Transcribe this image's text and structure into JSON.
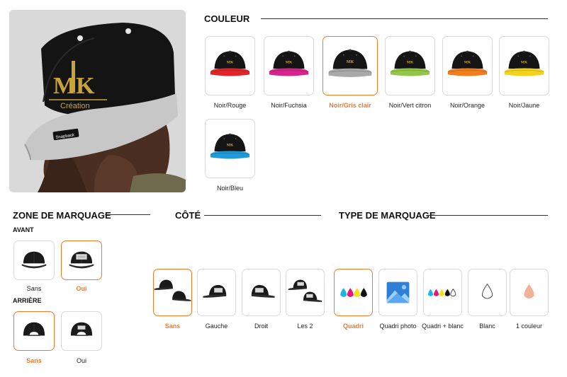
{
  "brand": {
    "logo_line1": "MK",
    "logo_line2": "Création",
    "badge": "Snapback"
  },
  "couleur": {
    "title": "COULEUR",
    "options": [
      {
        "label": "Noir/Rouge",
        "visor": "#e0252a",
        "selected": false
      },
      {
        "label": "Noir/Fuchsia",
        "visor": "#d6248d",
        "selected": false
      },
      {
        "label": "Noir/Gris clair",
        "visor": "#a9a9a9",
        "selected": true
      },
      {
        "label": "Noir/Vert citron",
        "visor": "#93c548",
        "selected": false
      },
      {
        "label": "Noir/Orange",
        "visor": "#f07e1e",
        "selected": false
      },
      {
        "label": "Noir/Jaune",
        "visor": "#f3d21f",
        "selected": false
      },
      {
        "label": "Noir/Bleu",
        "visor": "#1e9bd8",
        "selected": false
      }
    ]
  },
  "zone": {
    "title": "ZONE DE MARQUAGE",
    "avant_label": "AVANT",
    "arriere_label": "ARRIÈRE",
    "avant": [
      {
        "label": "Sans",
        "selected": false
      },
      {
        "label": "Oui",
        "selected": true
      }
    ],
    "arriere": [
      {
        "label": "Sans",
        "selected": true
      },
      {
        "label": "Oui",
        "selected": false
      }
    ]
  },
  "cote": {
    "title": "CÔTÉ",
    "options": [
      {
        "label": "Sans",
        "selected": true
      },
      {
        "label": "Gauche",
        "selected": false
      },
      {
        "label": "Droit",
        "selected": false
      },
      {
        "label": "Les 2",
        "selected": false
      }
    ]
  },
  "type": {
    "title": "TYPE DE MARQUAGE",
    "options": [
      {
        "label": "Quadri",
        "selected": true
      },
      {
        "label": "Quadri photo",
        "selected": false
      },
      {
        "label": "Quadri + blanc",
        "selected": false
      },
      {
        "label": "Blanc",
        "selected": false
      },
      {
        "label": "1 couleur",
        "selected": false
      }
    ]
  },
  "colors": {
    "accent": "#f07a2c",
    "gold": "#c9a23a",
    "cyan": "#19b6e8",
    "magenta": "#e5177f",
    "yellow": "#f5e01b",
    "black": "#111111",
    "peach": "#efb199"
  }
}
